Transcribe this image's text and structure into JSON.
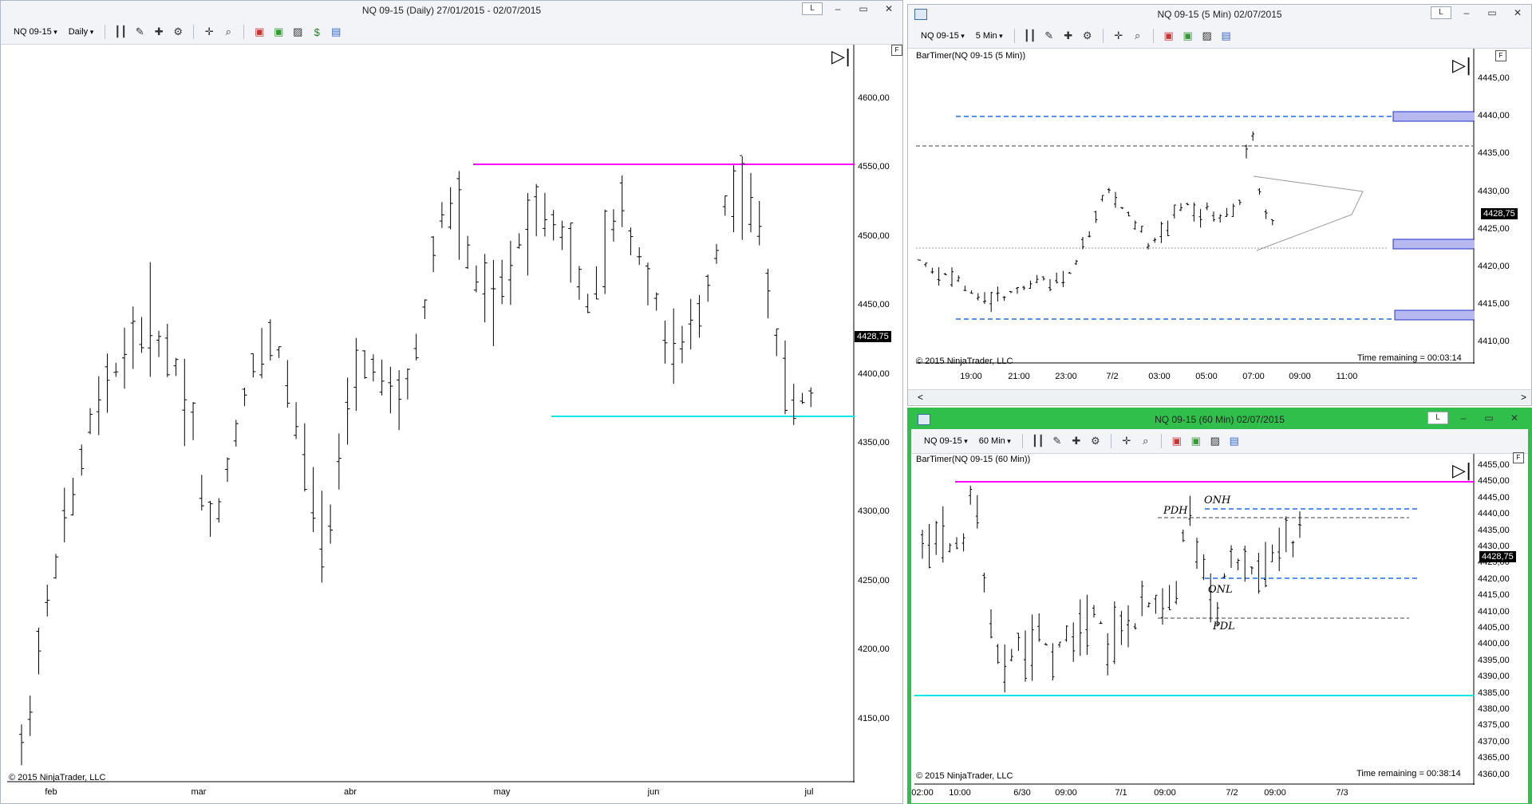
{
  "left": {
    "title": "NQ 09-15 (Daily)  27/01/2015 - 02/07/2015",
    "instrument": "NQ 09-15",
    "period": "Daily",
    "win_btn_l": "L",
    "win_btn_min": "▭",
    "win_btn_close": "✕",
    "y_ticks": [
      "4600,00",
      "4550,00",
      "4500,00",
      "4450,00",
      "4400,00",
      "4350,00",
      "4300,00",
      "4250,00",
      "4200,00",
      "4150,00"
    ],
    "x_ticks": [
      "feb",
      "mar",
      "abr",
      "may",
      "jun",
      "jul"
    ],
    "last_price": "4428,75",
    "copyright": "© 2015 NinjaTrader, LLC",
    "f_box": "F",
    "line_colors": {
      "resistance": "#ff00ff",
      "support": "#00e5e5"
    }
  },
  "right_top": {
    "title": "NQ 09-15 (5 Min)  02/07/2015",
    "instrument": "NQ 09-15",
    "period": "5 Min",
    "indicator": "BarTimer(NQ 09-15 (5 Min))",
    "y_ticks": [
      "4445,00",
      "4440,00",
      "4435,00",
      "4430,00",
      "4425,00",
      "4420,00",
      "4415,00",
      "4410,00"
    ],
    "x_ticks": [
      "19:00",
      "21:00",
      "23:00",
      "7/2",
      "03:00",
      "05:00",
      "07:00",
      "09:00",
      "11:00"
    ],
    "last_price": "4428,75",
    "copyright": "© 2015 NinjaTrader, LLC",
    "time_remaining": "Time remaining = 00:03:14",
    "f_box": "F",
    "scroll_left": "<",
    "scroll_right": ">"
  },
  "right_bottom": {
    "title": "NQ 09-15 (60 Min)  02/07/2015",
    "instrument": "NQ 09-15",
    "period": "60 Min",
    "indicator": "BarTimer(NQ 09-15 (60 Min))",
    "y_ticks": [
      "4455,00",
      "4450,00",
      "4445,00",
      "4440,00",
      "4435,00",
      "4430,00",
      "4425,00",
      "4420,00",
      "4415,00",
      "4410,00",
      "4405,00",
      "4400,00",
      "4395,00",
      "4390,00",
      "4385,00",
      "4380,00",
      "4375,00",
      "4370,00",
      "4365,00",
      "4360,00"
    ],
    "x_ticks": [
      "02:00",
      "10:00",
      "6/30",
      "09:00",
      "7/1",
      "09:00",
      "7/2",
      "09:00",
      "7/3"
    ],
    "last_price": "4428,75",
    "copyright": "© 2015 NinjaTrader, LLC",
    "time_remaining": "Time remaining = 00:38:14",
    "f_box": "F",
    "labels": {
      "onh": "ONH",
      "pdh": "PDH",
      "onl": "ONL",
      "pdl": "PDL"
    }
  }
}
